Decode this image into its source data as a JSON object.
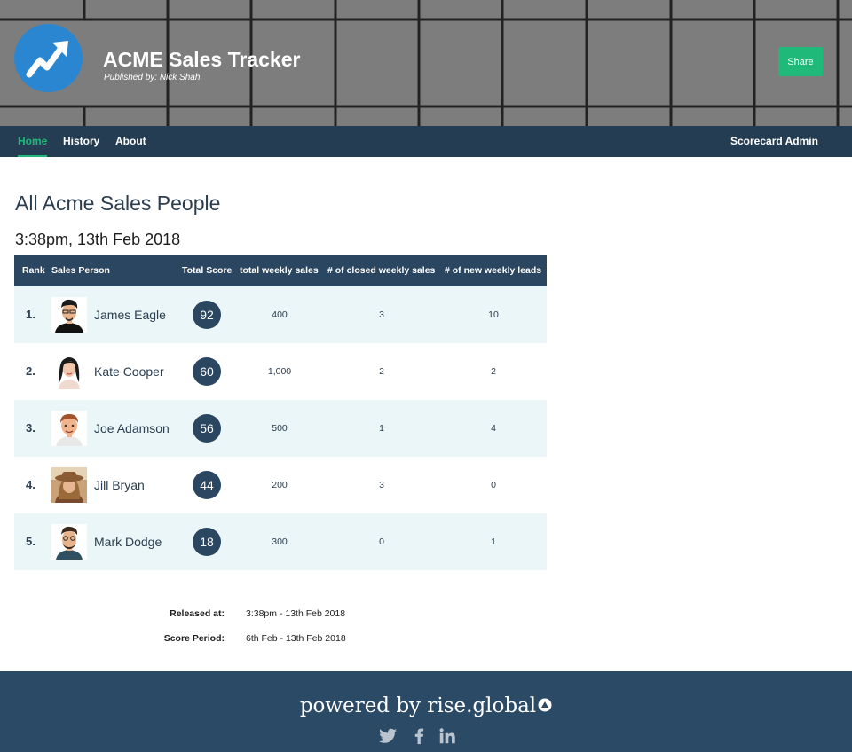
{
  "header": {
    "title": "ACME Sales Tracker",
    "published_by": "Published by: Nick Shah",
    "share_label": "Share",
    "logo_icon": "trend-up-icon"
  },
  "nav": {
    "items": [
      {
        "label": "Home",
        "active": true
      },
      {
        "label": "History",
        "active": false
      },
      {
        "label": "About",
        "active": false
      }
    ],
    "admin_label": "Scorecard Admin"
  },
  "main": {
    "title": "All Acme Sales People",
    "timestamp": "3:38pm, 13th Feb 2018"
  },
  "table": {
    "headers": {
      "rank": "Rank",
      "person": "Sales Person",
      "score": "Total Score",
      "weekly_sales": "total weekly sales",
      "closed_sales": "# of closed weekly sales",
      "new_leads": "# of new weekly leads"
    },
    "rows": [
      {
        "rank": "1.",
        "name": "James Eagle",
        "score": "92",
        "weekly_sales": "400",
        "closed_sales": "3",
        "new_leads": "10"
      },
      {
        "rank": "2.",
        "name": "Kate Cooper",
        "score": "60",
        "weekly_sales": "1,000",
        "closed_sales": "2",
        "new_leads": "2"
      },
      {
        "rank": "3.",
        "name": "Joe Adamson",
        "score": "56",
        "weekly_sales": "500",
        "closed_sales": "1",
        "new_leads": "4"
      },
      {
        "rank": "4.",
        "name": "Jill Bryan",
        "score": "44",
        "weekly_sales": "200",
        "closed_sales": "3",
        "new_leads": "0"
      },
      {
        "rank": "5.",
        "name": "Mark Dodge",
        "score": "18",
        "weekly_sales": "300",
        "closed_sales": "0",
        "new_leads": "1"
      }
    ]
  },
  "meta": {
    "released_label": "Released at:",
    "released_value": "3:38pm - 13th Feb 2018",
    "period_label": "Score Period:",
    "period_value": "6th Feb - 13th Feb 2018"
  },
  "footer": {
    "powered_text": "powered by rise.global",
    "social_icons": [
      "twitter-icon",
      "facebook-icon",
      "linkedin-icon"
    ]
  },
  "colors": {
    "accent": "#1fb97a",
    "nav_bg": "#243d52",
    "header_bg": "#2b4660",
    "row_tint": "#eaf6f7",
    "footer_bg": "#2b4a66",
    "logo_blue": "#2a86d1"
  }
}
